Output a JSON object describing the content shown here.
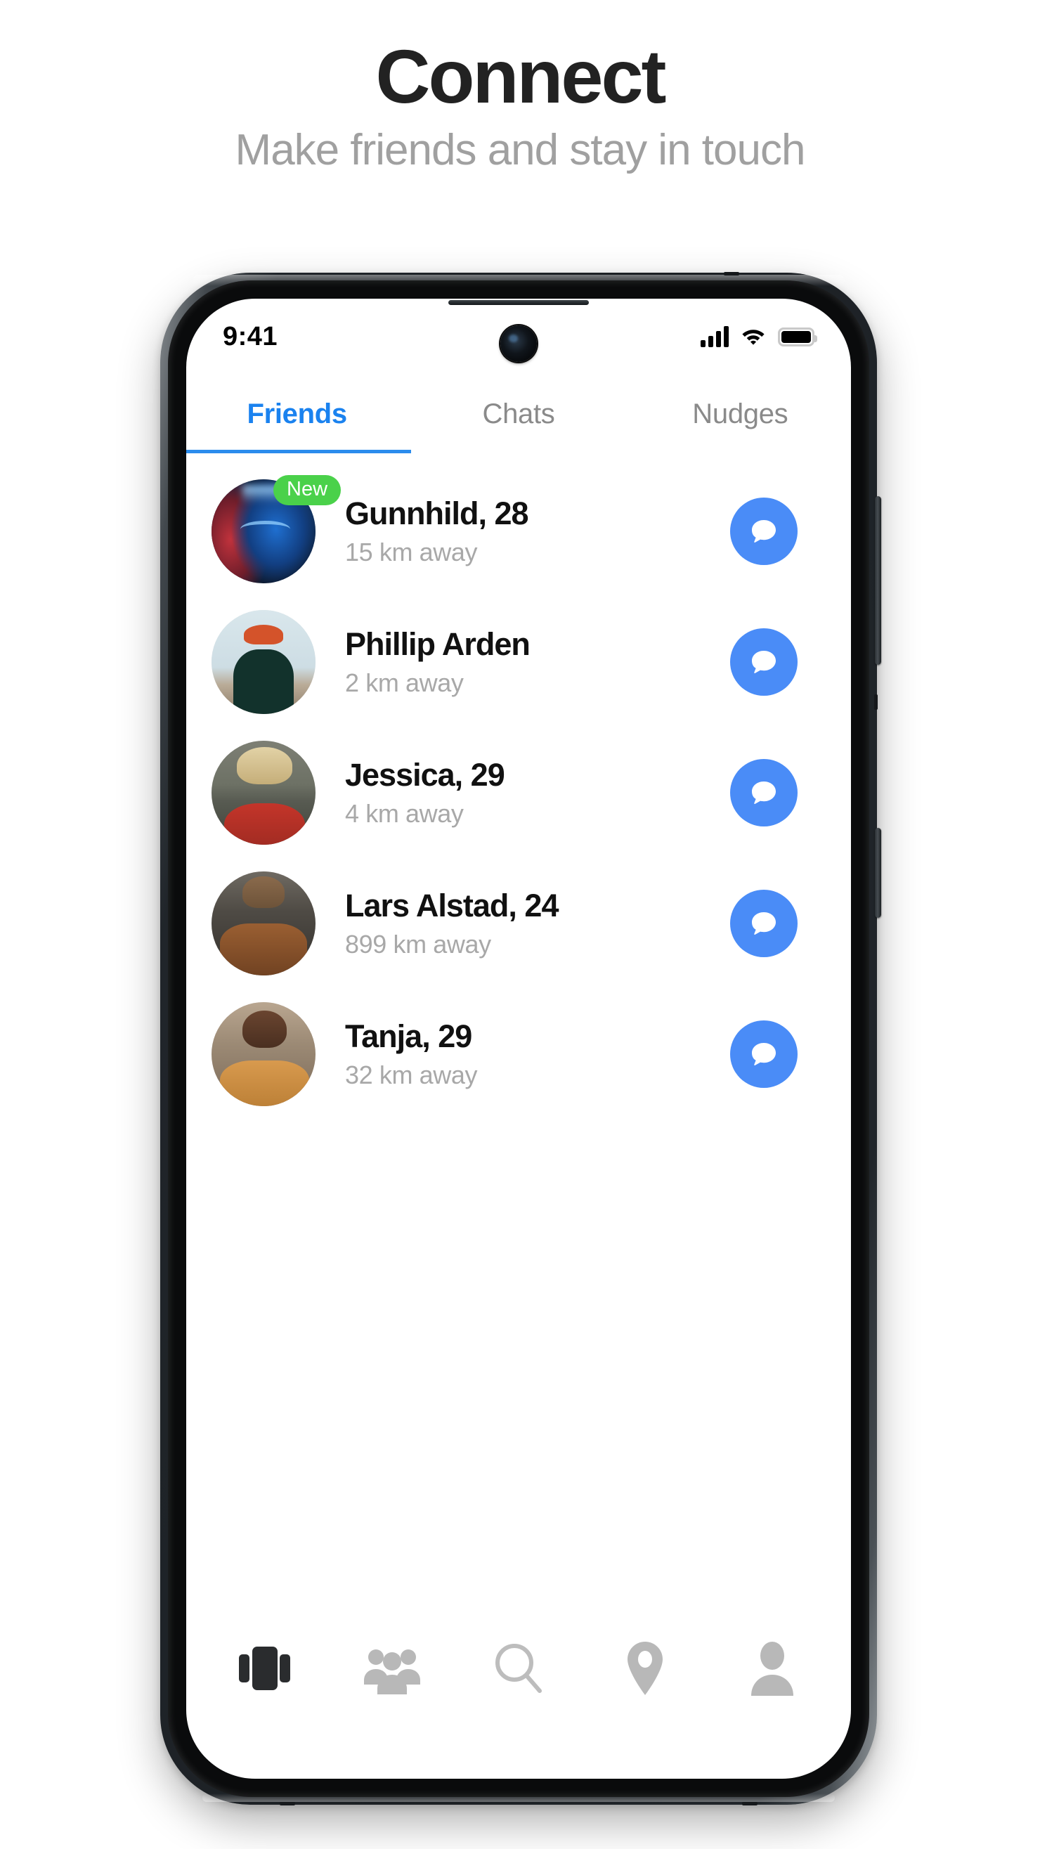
{
  "header": {
    "title": "Connect",
    "subtitle": "Make friends and stay in touch"
  },
  "colors": {
    "accent_blue": "#2b8ced",
    "chat_button_blue": "#4a8cf7",
    "badge_green": "#4ad14a",
    "muted_text": "#a8a8a8",
    "tab_inactive": "#8a8a8a",
    "title_dark": "#222222",
    "subtitle_gray": "#a0a0a0"
  },
  "status_bar": {
    "time": "9:41",
    "signal_icon": "cellular-signal-icon",
    "wifi_icon": "wifi-icon",
    "battery_icon": "battery-full-icon",
    "camera": "front-camera-punch-hole"
  },
  "tabs": [
    {
      "label": "Friends",
      "active": true
    },
    {
      "label": "Chats",
      "active": false
    },
    {
      "label": "Nudges",
      "active": false
    }
  ],
  "friends": [
    {
      "name": "Gunnhild, 28",
      "distance": "15 km away",
      "badge": "New",
      "has_badge": true,
      "avatar": "avatar-gunnhild",
      "action_icon": "chat-bubble-icon"
    },
    {
      "name": "Phillip Arden",
      "distance": "2 km away",
      "badge": "",
      "has_badge": false,
      "avatar": "avatar-phillip",
      "action_icon": "chat-bubble-icon"
    },
    {
      "name": "Jessica, 29",
      "distance": "4 km away",
      "badge": "",
      "has_badge": false,
      "avatar": "avatar-jessica",
      "action_icon": "chat-bubble-icon"
    },
    {
      "name": "Lars Alstad, 24",
      "distance": "899 km away",
      "badge": "",
      "has_badge": false,
      "avatar": "avatar-lars",
      "action_icon": "chat-bubble-icon"
    },
    {
      "name": "Tanja, 29",
      "distance": "32 km away",
      "badge": "",
      "has_badge": false,
      "avatar": "avatar-tanja",
      "action_icon": "chat-bubble-icon"
    }
  ],
  "bottom_nav": [
    {
      "icon": "cards-stack-icon",
      "active": true
    },
    {
      "icon": "people-group-icon",
      "active": false
    },
    {
      "icon": "search-icon",
      "active": false
    },
    {
      "icon": "location-pin-icon",
      "active": false
    },
    {
      "icon": "profile-person-icon",
      "active": false
    }
  ]
}
